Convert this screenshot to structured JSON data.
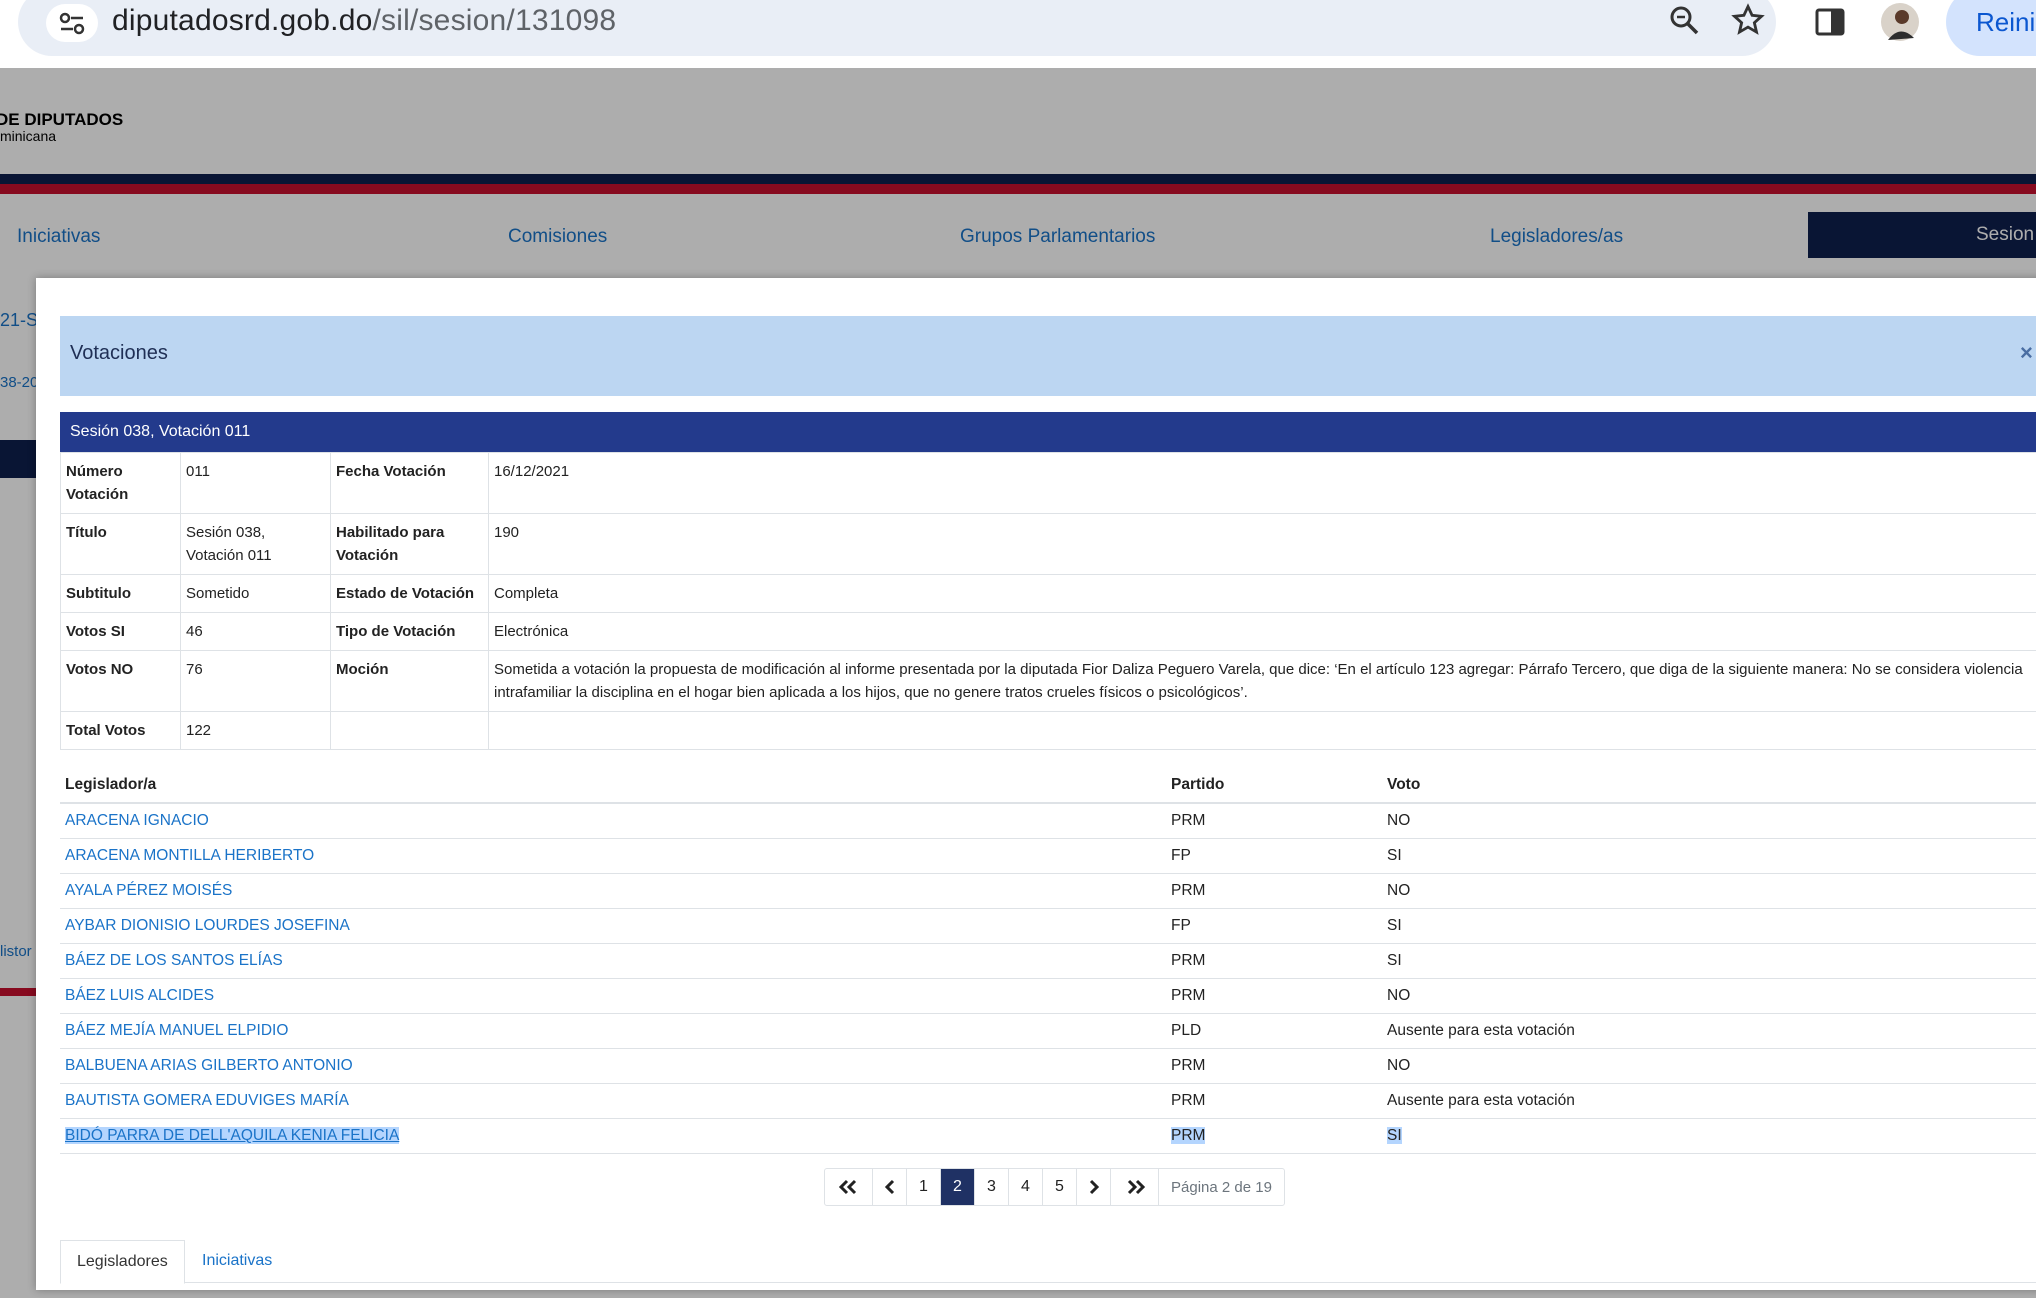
{
  "browser": {
    "url_domain": "diputadosrd.gob.do",
    "url_path": "/sil/sesion/131098",
    "profile_button": "Reini"
  },
  "site": {
    "logo_title": "DE DIPUTADOS",
    "logo_subtitle": "minicana",
    "nav": [
      "Iniciativas",
      "Comisiones",
      "Grupos Parlamentarios",
      "Legisladores/as",
      "Sesion"
    ],
    "side_fragments": [
      "21-S",
      "38-20",
      "listor"
    ]
  },
  "modal": {
    "title": "Votaciones",
    "close": "×",
    "section_title": "Sesión 038, Votación 011",
    "details": {
      "numero_label": "Número Votación",
      "numero": "011",
      "fecha_label": "Fecha Votación",
      "fecha": "16/12/2021",
      "titulo_label": "Título",
      "titulo": "Sesión 038, Votación 011",
      "habilitado_label": "Habilitado para Votación",
      "habilitado": "190",
      "subtitulo_label": "Subtitulo",
      "subtitulo": "Sometido",
      "estado_label": "Estado de Votación",
      "estado": "Completa",
      "si_label": "Votos SI",
      "si": "46",
      "tipo_label": "Tipo de Votación",
      "tipo": "Electrónica",
      "no_label": "Votos NO",
      "no": "76",
      "mocion_label": "Moción",
      "mocion": "Sometida a votación la propuesta de modificación al informe presentada por la diputada Fior Daliza Peguero Varela, que dice: ‘En el artículo 123 agregar: Párrafo Tercero, que diga de la siguiente manera: No se considera violencia intrafamiliar la disciplina en el hogar bien aplicada a los hijos, que no genere tratos crueles físicos o psicológicos’.",
      "total_label": "Total Votos",
      "total": "122"
    },
    "columns": [
      "Legislador/a",
      "Partido",
      "Voto"
    ],
    "rows": [
      {
        "name": "ARACENA IGNACIO",
        "party": "PRM",
        "vote": "NO"
      },
      {
        "name": "ARACENA MONTILLA HERIBERTO",
        "party": "FP",
        "vote": "SI"
      },
      {
        "name": "AYALA PÉREZ MOISÉS",
        "party": "PRM",
        "vote": "NO"
      },
      {
        "name": "AYBAR DIONISIO LOURDES JOSEFINA",
        "party": "FP",
        "vote": "SI"
      },
      {
        "name": "BÁEZ DE LOS SANTOS ELÍAS",
        "party": "PRM",
        "vote": "SI"
      },
      {
        "name": "BÁEZ LUIS ALCIDES",
        "party": "PRM",
        "vote": "NO"
      },
      {
        "name": "BÁEZ MEJÍA MANUEL ELPIDIO",
        "party": "PLD",
        "vote": "Ausente para esta votación"
      },
      {
        "name": "BALBUENA ARIAS GILBERTO ANTONIO",
        "party": "PRM",
        "vote": "NO"
      },
      {
        "name": "BAUTISTA GOMERA EDUVIGES MARÍA",
        "party": "PRM",
        "vote": "Ausente para esta votación"
      },
      {
        "name": "BIDÓ PARRA DE DELL'AQUILA KENIA FELICIA",
        "party": "PRM",
        "vote": "SI"
      }
    ],
    "pagination": {
      "first": "«",
      "prev": "‹",
      "pages": [
        "1",
        "2",
        "3",
        "4",
        "5"
      ],
      "current": "2",
      "next": "›",
      "last": "»",
      "info": "Página 2 de 19"
    },
    "tabs": [
      "Legisladores",
      "Iniciativas"
    ]
  }
}
